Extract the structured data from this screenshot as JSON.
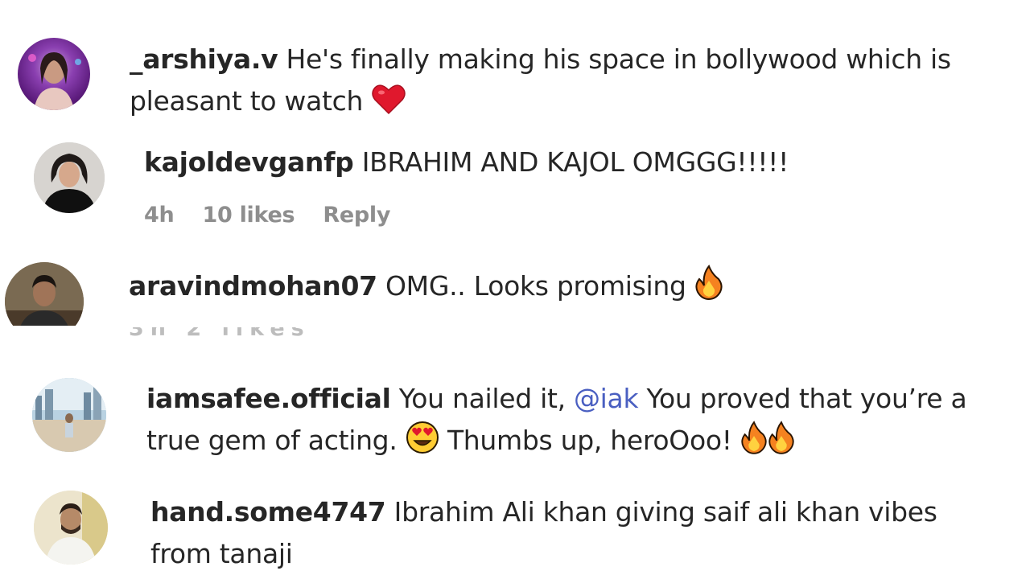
{
  "comments": [
    {
      "username": "_arshiya.v",
      "text_line1": "He's finally making his space in bollywood which is",
      "text_line2": "pleasant to watch",
      "emoji": "heart"
    },
    {
      "username": "kajoldevganfp",
      "text_line1": "IBRAHIM AND KAJOL OMGGG!!!!!",
      "meta": {
        "time": "4h",
        "likes": "10 likes",
        "reply": "Reply"
      }
    },
    {
      "username": "aravindmohan07",
      "text_line1": "OMG.. Looks promising",
      "emoji": "fire"
    },
    {
      "username": "iamsafee.official",
      "text_line1_before": "You nailed it,",
      "mention": "@iak",
      "text_line1_after": "You proved that you’re a",
      "text_line2": "true gem of acting.",
      "text_line2_after": "Thumbs up, heroOoo!",
      "emojis": [
        "heart-eyes",
        "fire",
        "fire"
      ]
    },
    {
      "username": "hand.some4747",
      "text_line1": "Ibrahim Ali khan giving saif ali khan vibes",
      "text_line2": "from tanaji"
    }
  ],
  "colors": {
    "text": "#262626",
    "meta": "#8e8e8e",
    "mention": "#4a5fc1",
    "heart": "#e0182d",
    "fire": "#f58220"
  }
}
